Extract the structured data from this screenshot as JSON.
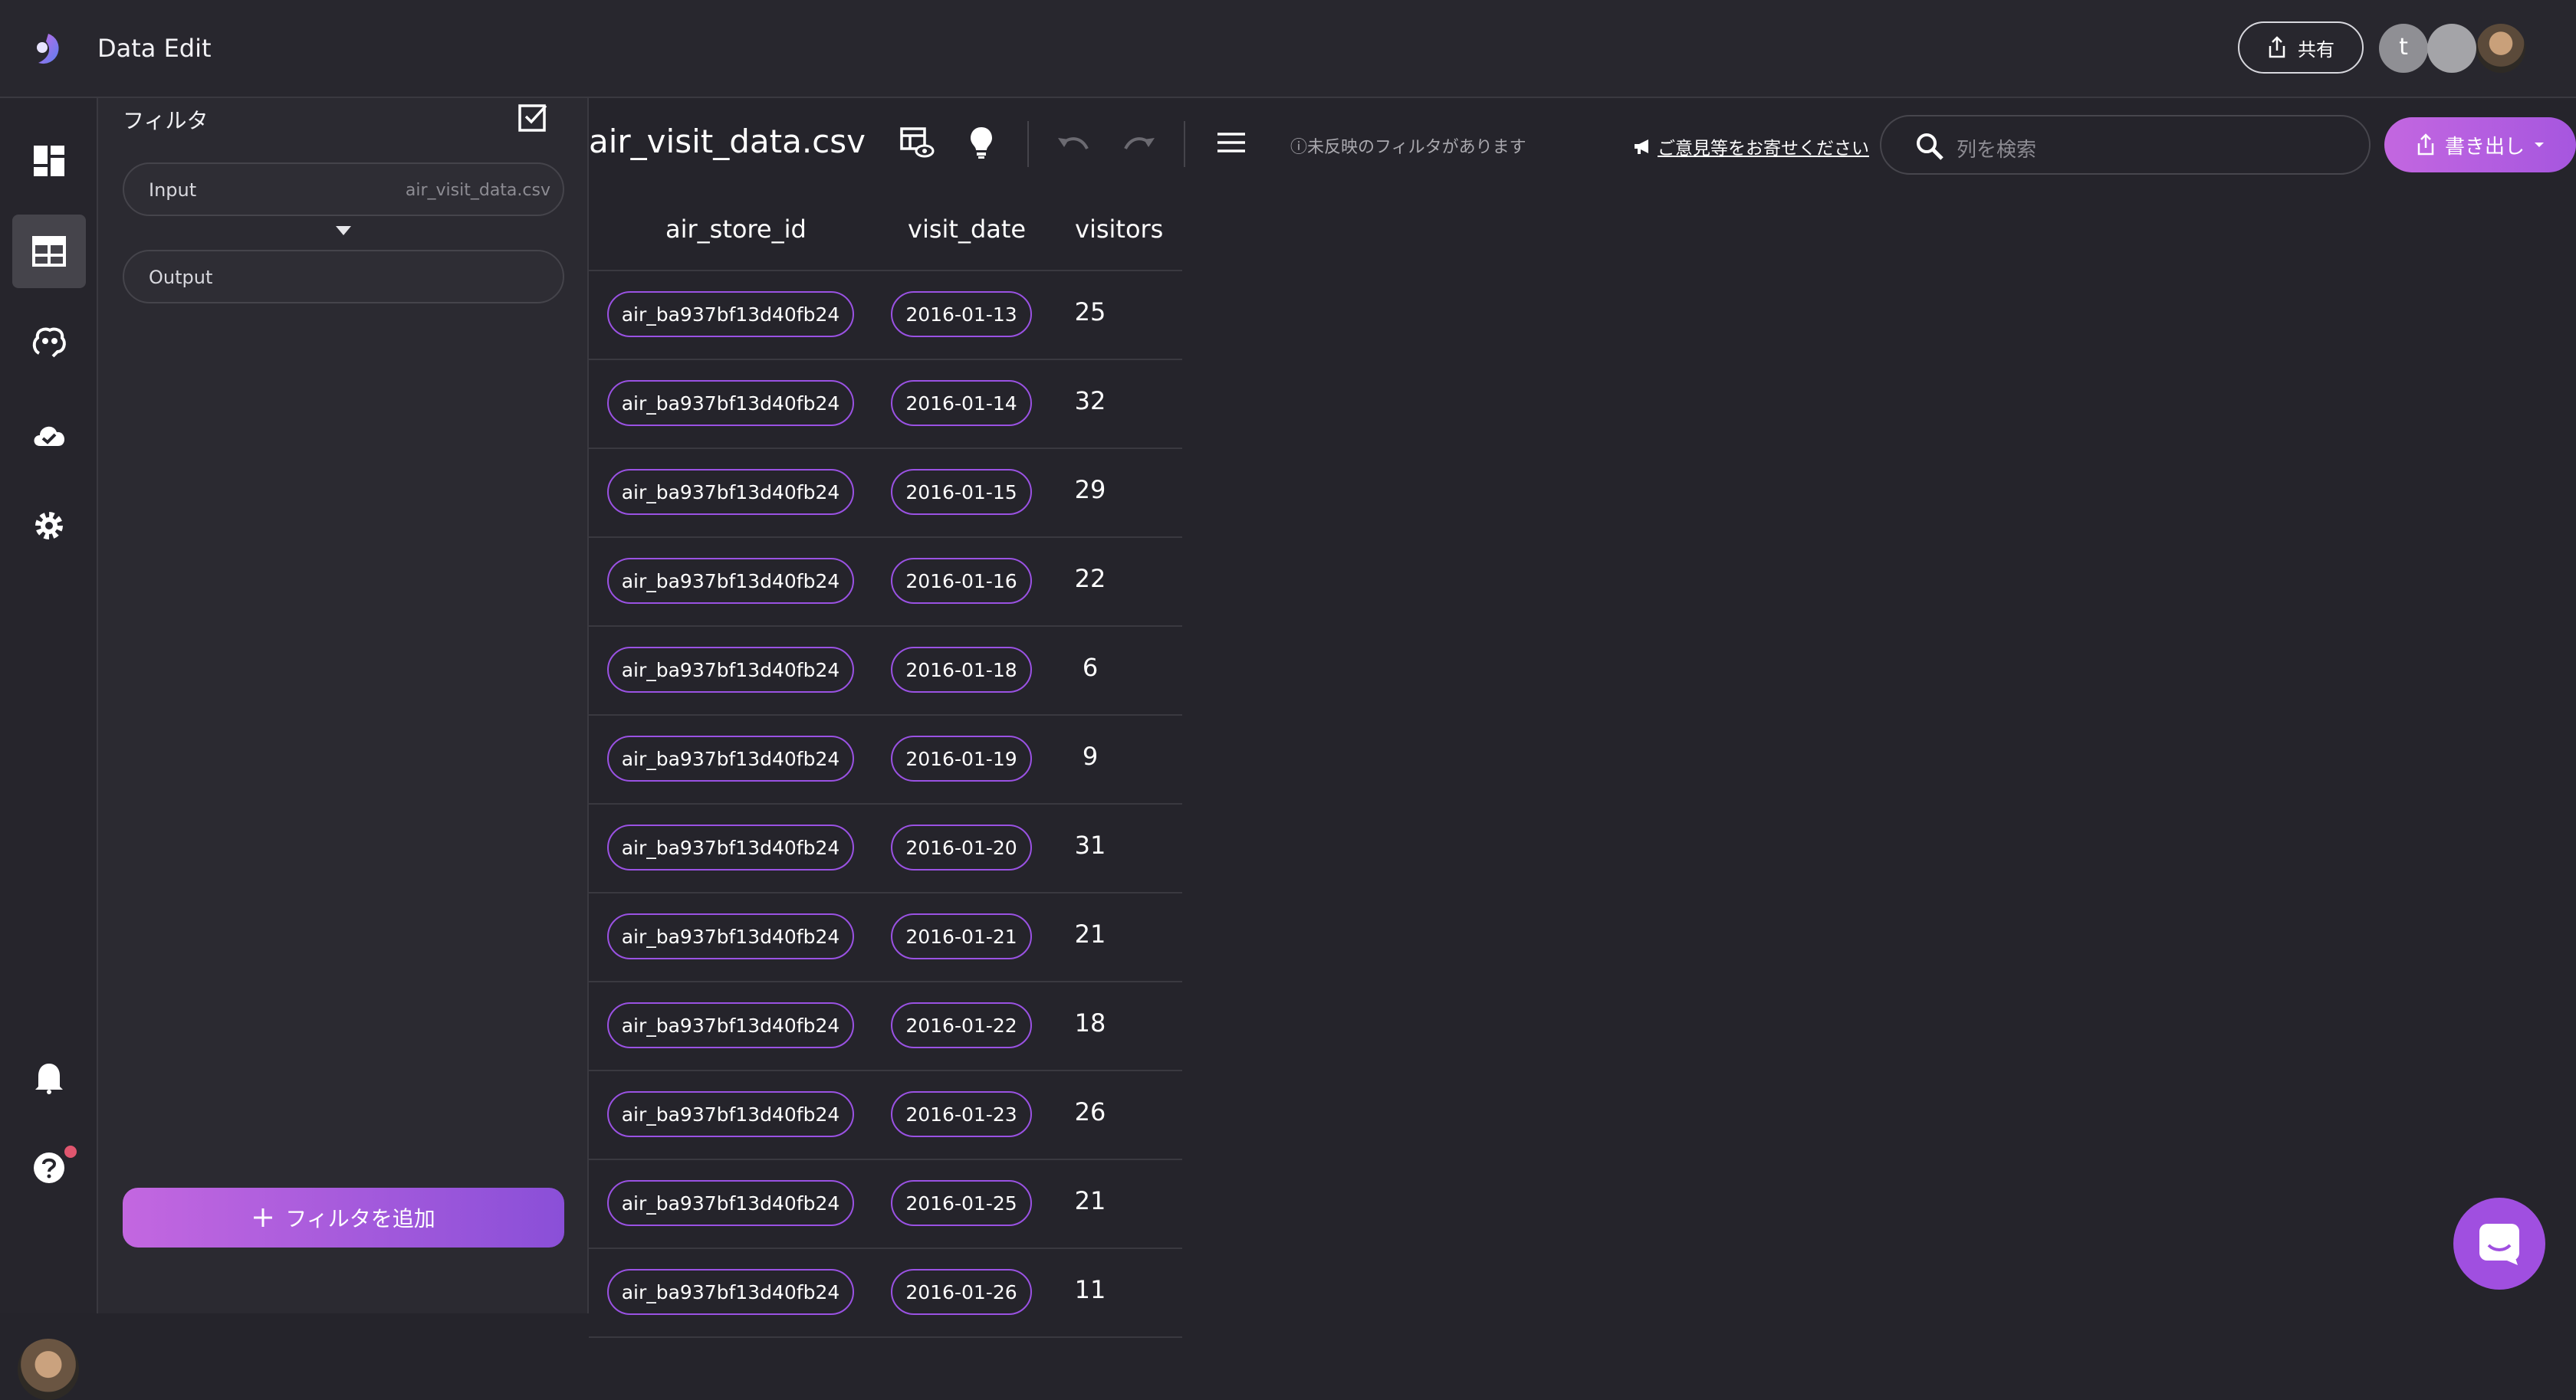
{
  "app": {
    "title": "Data Edit"
  },
  "header": {
    "share_label": "共有",
    "avatar_initial": "t"
  },
  "filter_panel": {
    "title": "フィルタ",
    "input_label": "Input",
    "input_value": "air_visit_data.csv",
    "output_label": "Output",
    "add_filter_label": "フィルタを追加"
  },
  "toolbar": {
    "file_name": "air_visit_data.csv",
    "notice": "未反映のフィルタがあります",
    "feedback_label": "ご意見等をお寄せください",
    "search_placeholder": "列を検索",
    "export_label": "書き出し"
  },
  "table": {
    "columns": [
      "air_store_id",
      "visit_date",
      "visitors"
    ],
    "rows": [
      [
        "air_ba937bf13d40fb24",
        "2016-01-13",
        "25"
      ],
      [
        "air_ba937bf13d40fb24",
        "2016-01-14",
        "32"
      ],
      [
        "air_ba937bf13d40fb24",
        "2016-01-15",
        "29"
      ],
      [
        "air_ba937bf13d40fb24",
        "2016-01-16",
        "22"
      ],
      [
        "air_ba937bf13d40fb24",
        "2016-01-18",
        "6"
      ],
      [
        "air_ba937bf13d40fb24",
        "2016-01-19",
        "9"
      ],
      [
        "air_ba937bf13d40fb24",
        "2016-01-20",
        "31"
      ],
      [
        "air_ba937bf13d40fb24",
        "2016-01-21",
        "21"
      ],
      [
        "air_ba937bf13d40fb24",
        "2016-01-22",
        "18"
      ],
      [
        "air_ba937bf13d40fb24",
        "2016-01-23",
        "26"
      ],
      [
        "air_ba937bf13d40fb24",
        "2016-01-25",
        "21"
      ],
      [
        "air_ba937bf13d40fb24",
        "2016-01-26",
        "11"
      ]
    ]
  },
  "colors": {
    "accent": "#9a52e3",
    "button_gradient_start": "#c367e0",
    "button_gradient_end": "#8a4fd8",
    "background": "#25242b"
  }
}
